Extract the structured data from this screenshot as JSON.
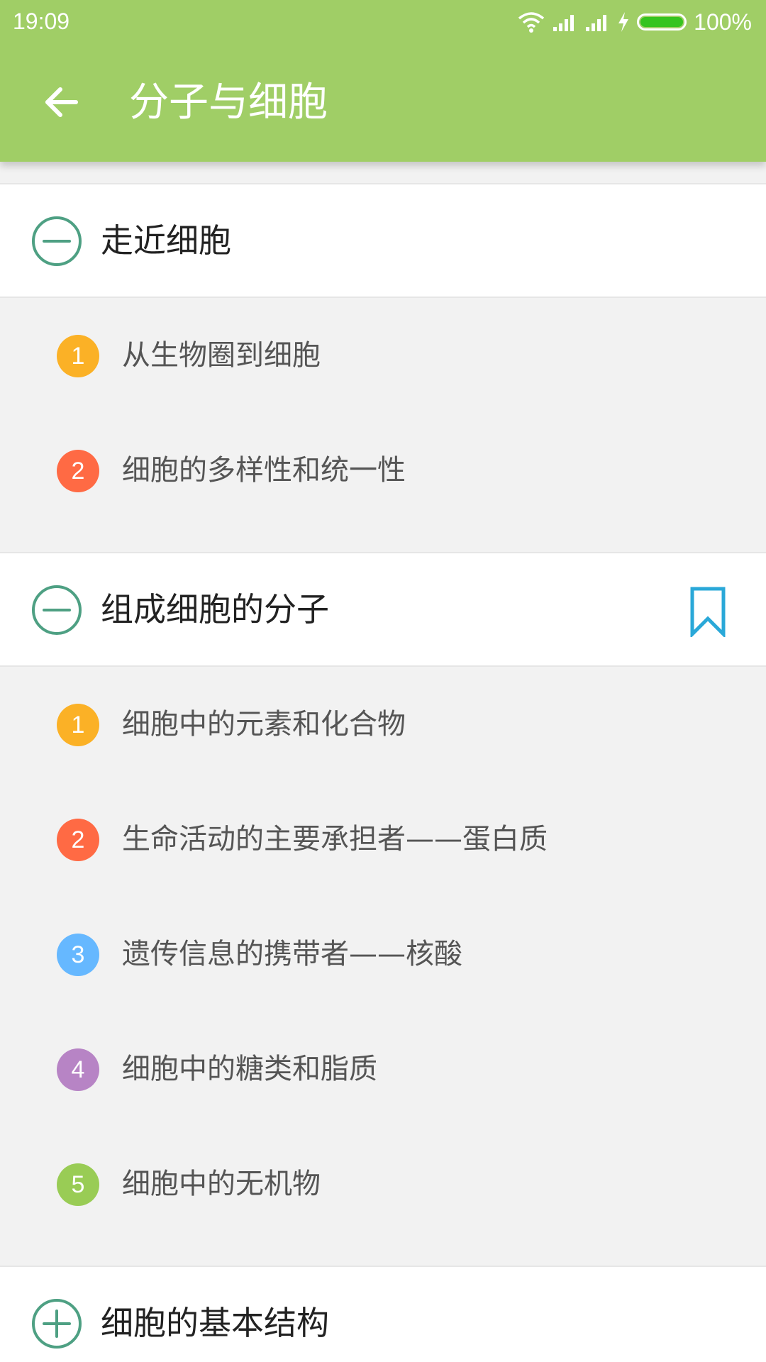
{
  "status": {
    "time": "19:09",
    "battery_text": "100%"
  },
  "appbar": {
    "title": "分子与细胞"
  },
  "groups": [
    {
      "title": "走近细胞",
      "expanded": true,
      "items": [
        {
          "num": "1",
          "label": "从生物圈到细胞",
          "color": "#fbb126"
        },
        {
          "num": "2",
          "label": "细胞的多样性和统一性",
          "color": "#ff6a44"
        }
      ]
    },
    {
      "title": "组成细胞的分子",
      "expanded": true,
      "bookmarked": true,
      "items": [
        {
          "num": "1",
          "label": "细胞中的元素和化合物",
          "color": "#fbb126"
        },
        {
          "num": "2",
          "label": "生命活动的主要承担者——蛋白质",
          "color": "#ff6a44"
        },
        {
          "num": "3",
          "label": "遗传信息的携带者——核酸",
          "color": "#66b8ff"
        },
        {
          "num": "4",
          "label": "细胞中的糖类和脂质",
          "color": "#b784c5"
        },
        {
          "num": "5",
          "label": "细胞中的无机物",
          "color": "#99cc55"
        }
      ]
    },
    {
      "title": "细胞的基本结构",
      "expanded": false,
      "items": []
    }
  ],
  "colors": {
    "appbar": "#a0ce66",
    "toggle": "#4ea083",
    "bookmark": "#2aa8d8"
  }
}
